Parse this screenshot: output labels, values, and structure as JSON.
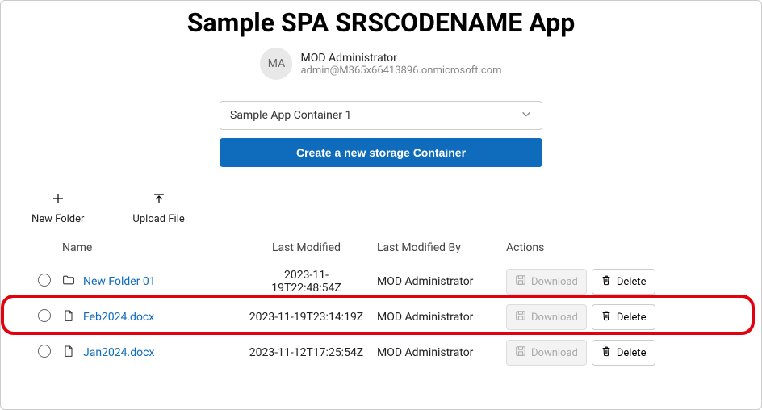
{
  "title": "Sample SPA SRSCODENAME App",
  "user": {
    "initials": "MA",
    "name": "MOD Administrator",
    "email": "admin@M365x66413896.onmicrosoft.com"
  },
  "containerSelect": {
    "selected": "Sample App Container 1"
  },
  "createContainerLabel": "Create a new storage Container",
  "toolbar": {
    "newFolder": "New Folder",
    "uploadFile": "Upload File"
  },
  "columns": {
    "name": "Name",
    "lastModified": "Last Modified",
    "lastModifiedBy": "Last Modified By",
    "actions": "Actions"
  },
  "buttons": {
    "download": "Download",
    "delete": "Delete"
  },
  "rows": [
    {
      "type": "folder",
      "name": "New Folder 01",
      "lastModified": "2023-11-19T22:48:54Z",
      "lastModifiedBy": "MOD Administrator",
      "downloadDisabled": true,
      "highlighted": false
    },
    {
      "type": "file",
      "name": "Feb2024.docx",
      "lastModified": "2023-11-19T23:14:19Z",
      "lastModifiedBy": "MOD Administrator",
      "downloadDisabled": true,
      "highlighted": true
    },
    {
      "type": "file",
      "name": "Jan2024.docx",
      "lastModified": "2023-11-12T17:25:54Z",
      "lastModifiedBy": "MOD Administrator",
      "downloadDisabled": true,
      "highlighted": false
    }
  ]
}
